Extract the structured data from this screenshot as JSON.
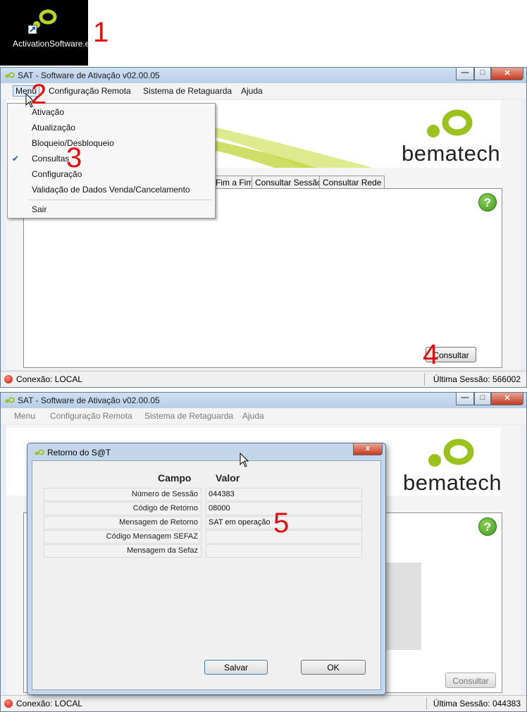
{
  "desktop": {
    "icon_label": "ActivationSoftware.exe",
    "icon_name": "bematech-shortcut-icon"
  },
  "steps": {
    "s1": "1",
    "s2": "2",
    "s3": "3",
    "s4": "4",
    "s5": "5"
  },
  "window": {
    "title": "SAT - Software de Ativação v02.00.05",
    "menu": [
      "Menu",
      "Configuração Remota",
      "Sistema de Retaguarda",
      "Ajuda"
    ],
    "brand": "bematech",
    "tabs": [
      "Fim a Fim",
      "Consultar Sessão",
      "Consultar Rede"
    ],
    "help": "?",
    "consultar_button": "Consultar",
    "status_connection": "Conexão: LOCAL",
    "status_session_top": "Última Sessão: 566002",
    "status_session_bottom": "Última Sessão: 044383"
  },
  "dropdown": {
    "items": [
      "Ativação",
      "Atualização",
      "Bloqueio/Desbloqueio",
      "Consultas",
      "Configuração",
      "Validação de Dados Venda/Cancelamento"
    ],
    "exit": "Sair",
    "checked": "Consultas"
  },
  "dialog": {
    "title": "Retorno do S@T",
    "col_campo": "Campo",
    "col_valor": "Valor",
    "rows": [
      {
        "campo": "Número de Sessão",
        "valor": "044383"
      },
      {
        "campo": "Código de Retorno",
        "valor": "08000"
      },
      {
        "campo": "Mensagem de Retorno",
        "valor": "SAT em operação"
      },
      {
        "campo": "Código Mensagem SEFAZ",
        "valor": ""
      },
      {
        "campo": "Mensagem da Sefaz",
        "valor": ""
      }
    ],
    "save_button": "Salvar",
    "ok_button": "OK",
    "close_glyph": "x"
  },
  "colors": {
    "accent_green": "#9bc21c",
    "step_red": "#e01010",
    "titlebar": "#c5d8ee"
  }
}
